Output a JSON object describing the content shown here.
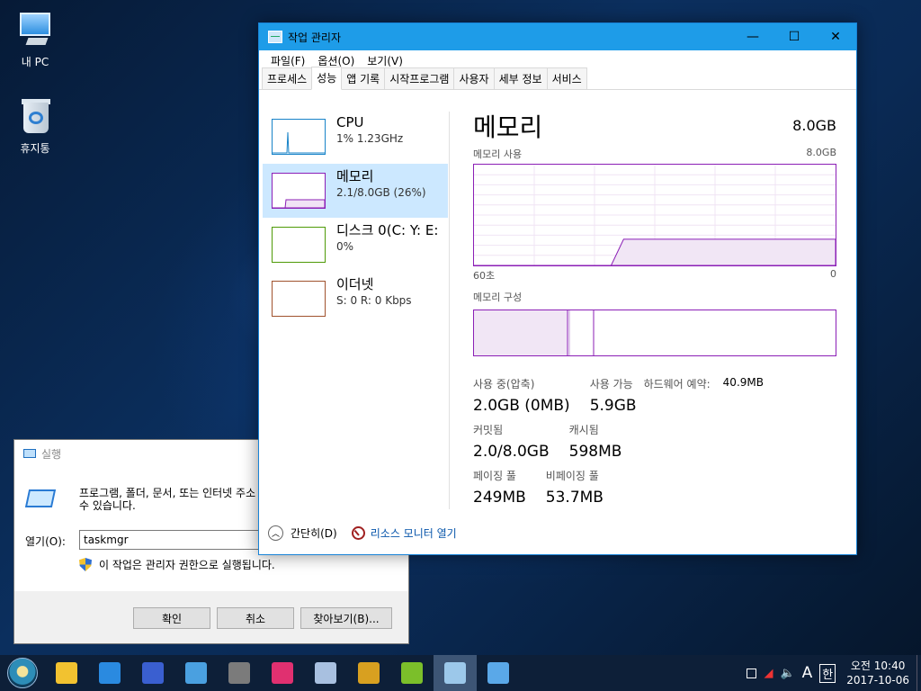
{
  "desktop": {
    "icons": [
      {
        "label": "내 PC"
      },
      {
        "label": "휴지통"
      }
    ]
  },
  "task_manager": {
    "title": "작업 관리자",
    "window_controls": {
      "minimize": "—",
      "maximize": "☐",
      "close": "✕"
    },
    "menu": [
      "파일(F)",
      "옵션(O)",
      "보기(V)"
    ],
    "tabs": [
      "프로세스",
      "성능",
      "앱 기록",
      "시작프로그램",
      "사용자",
      "세부 정보",
      "서비스"
    ],
    "active_tab": "성능",
    "resources": [
      {
        "name": "CPU",
        "value": "1% 1.23GHz",
        "color": "#1783c8"
      },
      {
        "name": "메모리",
        "value": "2.1/8.0GB (26%)",
        "color": "#8b1fb6"
      },
      {
        "name": "디스크 0(C: Y: E:",
        "value": "0%",
        "color": "#4e9a06"
      },
      {
        "name": "이더넷",
        "value": "S: 0 R: 0 Kbps",
        "color": "#a0522d"
      }
    ],
    "detail": {
      "heading": "메모리",
      "total": "8.0GB",
      "usage_label": "메모리 사용",
      "usage_max": "8.0GB",
      "time_left": "60초",
      "time_right": "0",
      "composition_label": "메모리 구성",
      "usage_history_fraction": [
        0,
        0,
        0,
        0,
        0,
        0,
        0,
        0,
        0,
        0,
        0,
        0,
        0.26,
        0.26,
        0.26,
        0.26,
        0.26,
        0.26,
        0.26,
        0.26,
        0.26,
        0.26,
        0.26,
        0.26,
        0.26,
        0.26,
        0.26,
        0.26,
        0.26,
        0.26
      ],
      "stats": {
        "in_use_label": "사용 중(압축)",
        "in_use_value": "2.0GB (0MB)",
        "available_label": "사용 가능",
        "available_value": "5.9GB",
        "hw_reserved_label": "하드웨어 예약:",
        "hw_reserved_value": "40.9MB",
        "committed_label": "커밋됨",
        "committed_value": "2.0/8.0GB",
        "cached_label": "캐시됨",
        "cached_value": "598MB",
        "paged_label": "페이징 풀",
        "paged_value": "249MB",
        "nonpaged_label": "비페이징 풀",
        "nonpaged_value": "53.7MB"
      }
    },
    "footer": {
      "fewer_details": "간단히(D)",
      "resource_monitor": "리소스 모니터 열기"
    }
  },
  "run_dialog": {
    "title": "실행",
    "description": "프로그램, 폴더, 문서, 또는 인터넷 주소\n수 있습니다.",
    "open_label": "열기(O):",
    "open_value": "taskmgr",
    "admin_note": "이 작업은 관리자 권한으로 실행됩니다.",
    "ok": "확인",
    "cancel": "취소",
    "browse": "찾아보기(B)..."
  },
  "taskbar": {
    "apps": [
      {
        "icon": "file-explorer-icon",
        "color": "#f2c230"
      },
      {
        "icon": "internet-explorer-icon",
        "color": "#2a8ae0"
      },
      {
        "icon": "save-disk-icon",
        "color": "#3a5fd0"
      },
      {
        "icon": "magnifier-icon",
        "color": "#4aa0e0"
      },
      {
        "icon": "robot-icon",
        "color": "#7b7b7b"
      },
      {
        "icon": "color-picker-icon",
        "color": "#e03070"
      },
      {
        "icon": "network-icon",
        "color": "#a8c0e0"
      },
      {
        "icon": "r-app-icon",
        "color": "#d8a020"
      },
      {
        "icon": "olive-app-icon",
        "color": "#7bbf2a"
      },
      {
        "icon": "task-manager-icon",
        "color": "#9cc8ea"
      },
      {
        "icon": "run-dialog-icon",
        "color": "#5aa8e8"
      }
    ],
    "tray": {
      "input_lang": "A",
      "ime": "한",
      "time": "오전 10:40",
      "date": "2017-10-06"
    }
  }
}
